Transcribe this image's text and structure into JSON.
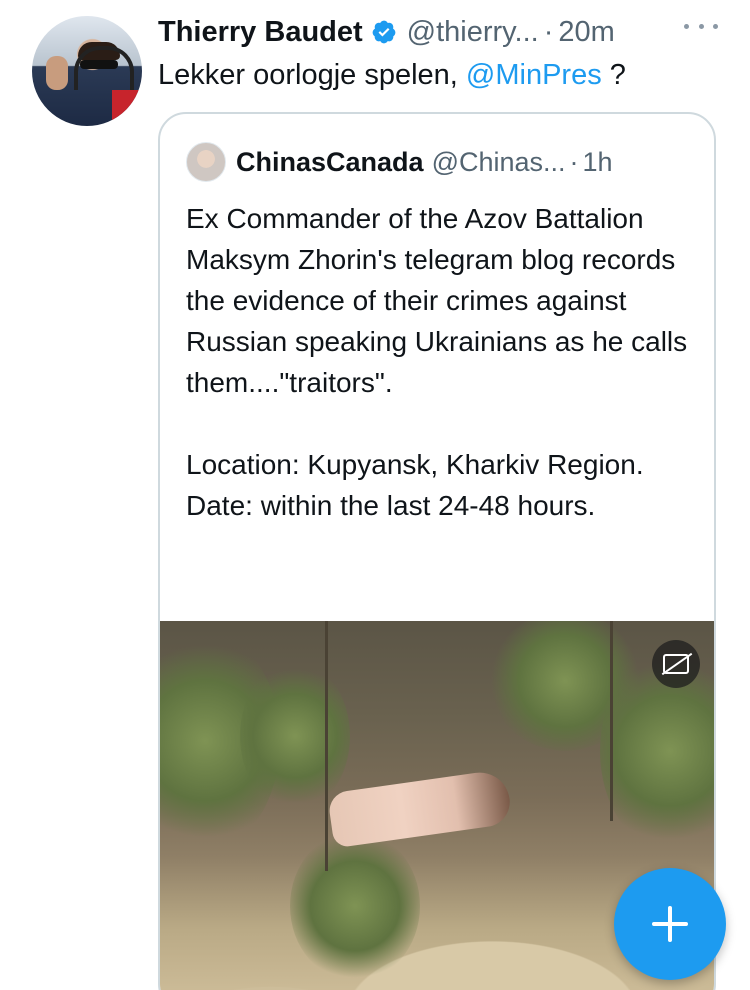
{
  "tweet": {
    "author_name": "Thierry Baudet",
    "handle": "@thierry...",
    "separator": "·",
    "time": "20m",
    "text_prefix": "Lekker oorlogje spelen, ",
    "mention": "@MinPres",
    "text_suffix": " ?",
    "icons": {
      "verified": "verified-badge-icon",
      "more": "more-options-icon"
    },
    "colors": {
      "link": "#1d9bf0",
      "secondary_text": "#536471"
    }
  },
  "quote": {
    "author_name": "ChinasCanada",
    "handle": "@Chinas...",
    "separator": "·",
    "time": "1h",
    "lines": [
      "Ex Commander of the Azov Battalion Maksym Zhorin's telegram blog records the evidence of their crimes against Russian speaking Ukrainians as he calls them....\"traitors\".",
      "",
      "Location: Kupyansk, Kharkiv Region.",
      "Date: within the last 24-48 hours."
    ],
    "media": {
      "type": "video",
      "captions_icon": "closed-captions-icon"
    }
  },
  "compose_button": {
    "icon": "plus-icon",
    "color": "#1d9bf0"
  }
}
